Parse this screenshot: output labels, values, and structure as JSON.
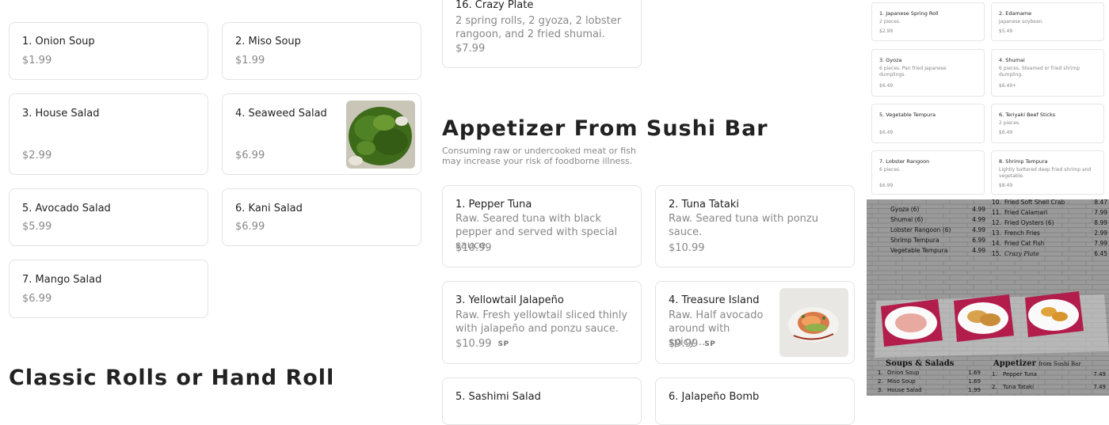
{
  "soups_salads": [
    {
      "name": "1. Onion Soup",
      "price": "$1.99"
    },
    {
      "name": "2. Miso Soup",
      "price": "$1.99"
    },
    {
      "name": "3. House Salad",
      "price": "$2.99"
    },
    {
      "name": "4. Seaweed Salad",
      "price": "$6.99"
    },
    {
      "name": "5. Avocado Salad",
      "price": "$5.99"
    },
    {
      "name": "6. Kani Salad",
      "price": "$6.99"
    },
    {
      "name": "7. Mango Salad",
      "price": "$6.99"
    }
  ],
  "classic_heading": "Classic Rolls or Hand Roll",
  "crazy_plate": {
    "name": "16. Crazy Plate",
    "desc": "2 spring rolls, 2 gyoza, 2 lobster rangoon, and 2 fried shumai.",
    "price": "$7.99"
  },
  "sushi_bar": {
    "heading": "Appetizer From Sushi Bar",
    "note": "Consuming raw or undercooked meat or fish may increase your risk of foodborne illness.",
    "items": [
      {
        "name": "1. Pepper Tuna",
        "desc": "Raw. Seared tuna with black pepper and served with special sauce.",
        "price": "$10.99"
      },
      {
        "name": "2. Tuna Tataki",
        "desc": "Raw. Seared tuna with ponzu sauce.",
        "price": "$10.99"
      },
      {
        "name": "3. Yellowtail Jalapeño",
        "desc": "Raw. Fresh yellowtail sliced thinly with jalapeño and ponzu sauce.",
        "price": "$10.99",
        "tag": "SP"
      },
      {
        "name": "4. Treasure Island",
        "desc": "Raw. Half avocado around with spicy…",
        "price": "$9.99",
        "tag": "SP"
      },
      {
        "name": "5. Sashimi Salad"
      },
      {
        "name": "6. Jalapeño Bomb"
      }
    ]
  },
  "kitchen_appetizers": [
    {
      "name": "1. Japanese Spring Roll",
      "desc": "2 pieces.",
      "price": "$2.99"
    },
    {
      "name": "2. Edamame",
      "desc": "Japanese soybean.",
      "price": "$5.49"
    },
    {
      "name": "3. Gyoza",
      "desc": "6 pieces. Pan fried Japanese dumplings.",
      "price": "$6.49"
    },
    {
      "name": "4. Shumai",
      "desc": "6 pieces. Steamed or fried shrimp dumpling.",
      "price": "$6.49+"
    },
    {
      "name": "5. Vegetable Tempura",
      "desc": "",
      "price": "$6.49"
    },
    {
      "name": "6. Teriyaki Beef Sticks",
      "desc": "2 pieces.",
      "price": "$6.49"
    },
    {
      "name": "7. Lobster Rangoon",
      "desc": "6 pieces.",
      "price": "$6.99"
    },
    {
      "name": "8. Shrimp Tempura",
      "desc": "Lightly battered deep fried shrimp and vegetable.",
      "price": "$8.49"
    }
  ],
  "menu_board": {
    "left_rows": [
      {
        "name": "Gyoza (6)",
        "price": "4.99"
      },
      {
        "name": "Shumai (6)",
        "price": "4.99"
      },
      {
        "name": "Lobster Rangoon (6)",
        "price": "4.99"
      },
      {
        "name": "Shrimp Tempura",
        "price": "6.99"
      },
      {
        "name": "Vegetable Tempura",
        "price": "4.99"
      }
    ],
    "right_rows": [
      {
        "num": "10.",
        "name": "Fried Soft Shell Crab",
        "price": "8.47"
      },
      {
        "num": "11.",
        "name": "Fried Calamari",
        "price": "7.99"
      },
      {
        "num": "12.",
        "name": "Fried Oysters (6)",
        "price": "8.99"
      },
      {
        "num": "13.",
        "name": "French Fries",
        "price": "2.99"
      },
      {
        "num": "14.",
        "name": "Fried Cat Fish",
        "price": "7.99"
      },
      {
        "num": "15.",
        "name": "Crazy Plate",
        "price": "6.45"
      }
    ],
    "soups_heading": "Soups & Salads",
    "soups_rows": [
      {
        "num": "1.",
        "name": "Onion Soup",
        "price": "1.69"
      },
      {
        "num": "2.",
        "name": "Miso Soup",
        "price": "1.69"
      },
      {
        "num": "3.",
        "name": "House Salad",
        "price": "1.99"
      }
    ],
    "appetizer_heading": "Appetizer",
    "appetizer_sub": "from Sushi Bar",
    "appetizer_rows": [
      {
        "num": "1.",
        "name": "Pepper Tuna",
        "price": "7.49"
      },
      {
        "num": "2.",
        "name": "Tuna Tataki",
        "price": "7.49"
      }
    ]
  }
}
